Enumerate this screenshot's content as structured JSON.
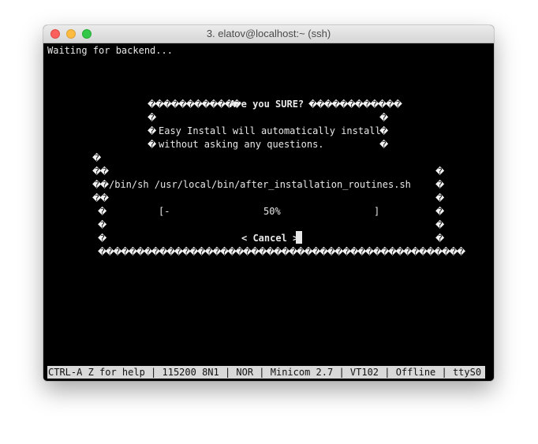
{
  "window": {
    "title": "3. elatov@localhost:~ (ssh)"
  },
  "terminal": {
    "line_waiting": "Waiting for backend...",
    "dialog": {
      "title": " Are you SURE? ",
      "message_line1": "Easy Install will automatically install",
      "message_line2": "without asking any questions."
    },
    "gauge": {
      "command": "/bin/sh /usr/local/bin/after_installation_routines.sh",
      "bar_left": "[-",
      "percent_label": "50%",
      "bar_right": "]",
      "progress": 0.5
    },
    "cancel_button": "< Cancel >"
  },
  "statusbar": {
    "text": "CTRL-A Z for help | 115200 8N1 | NOR | Minicom 2.7 | VT102 | Offline | ttyS0"
  },
  "glyph": "�",
  "colors": {
    "terminal_bg": "#000000",
    "terminal_fg": "#e8e8e8",
    "statusbar_bg": "#d9d9d9"
  }
}
